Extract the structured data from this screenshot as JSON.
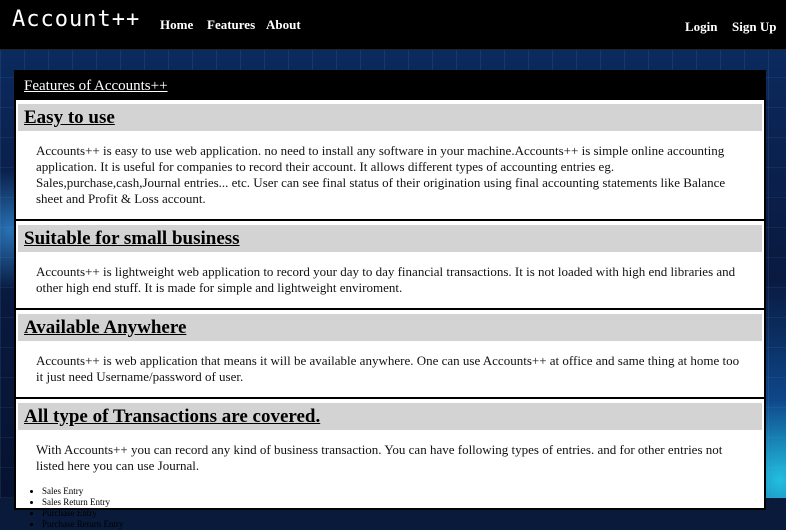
{
  "header": {
    "logo": "Account++",
    "nav": [
      "Home",
      "Features",
      "About"
    ],
    "login": "Login",
    "signup": "Sign Up"
  },
  "panel": {
    "title": "Features of Accounts++",
    "sections": [
      {
        "heading": "Easy to use",
        "text": "Accounts++ is easy to use web application. no need to install any software in your machine.Accounts++ is simple online accounting application. It is useful for companies to record their account. It allows different types of accounting entries eg. Sales,purchase,cash,Journal entries... etc. User can see final status of their origination using final accounting statements like Balance sheet and Profit & Loss account."
      },
      {
        "heading": "Suitable for small business",
        "text": "Accounts++ is lightweight web application to record your day to day financial transactions. It is not loaded with high end libraries and other high end stuff. It is made for simple and lightweight enviroment."
      },
      {
        "heading": "Available Anywhere",
        "text": "Accounts++ is web application that means it will be available anywhere. One can use Accounts++ at office and same thing at home too it just need Username/password of user."
      },
      {
        "heading": "All type of Transactions are covered.",
        "text": "With Accounts++ you can record any kind of business transaction. You can have following types of entries. and for other entries not listed here you can use Journal.",
        "entries": [
          "Sales Entry",
          "Sales Return Entry",
          "Purchase Entry",
          "Purchase Return Entry"
        ]
      }
    ]
  }
}
